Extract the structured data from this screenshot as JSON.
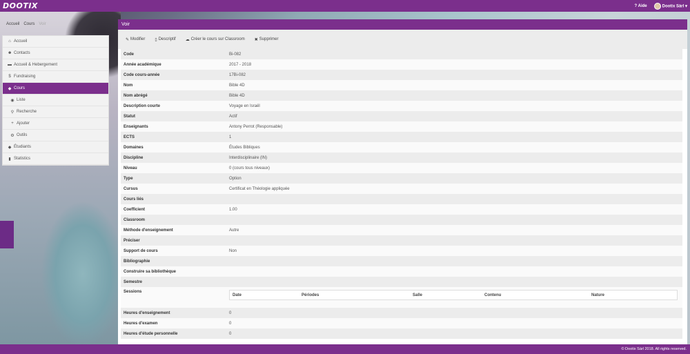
{
  "app": {
    "logo": "DOOTIX",
    "help": "Aide",
    "user": "Dootix Sàrl"
  },
  "breadcrumb": [
    "Accueil",
    "Cours",
    "Voir"
  ],
  "sidebar": {
    "items": [
      {
        "label": "Accueil",
        "icon": "home-icon",
        "glyph": "⌂"
      },
      {
        "label": "Contacts",
        "icon": "users-icon",
        "glyph": "☻"
      },
      {
        "label": "Accueil & Hebergement",
        "icon": "bed-icon",
        "glyph": "▬"
      },
      {
        "label": "Fundraising",
        "icon": "dollar-icon",
        "glyph": "$"
      },
      {
        "label": "Cours",
        "icon": "graduation-cap-icon",
        "glyph": "◆"
      },
      {
        "label": "Liste",
        "icon": "eye-icon",
        "glyph": "◉"
      },
      {
        "label": "Recherche",
        "icon": "search-icon",
        "glyph": "⚲"
      },
      {
        "label": "Ajouter",
        "icon": "plus-icon",
        "glyph": "+"
      },
      {
        "label": "Outils",
        "icon": "gear-icon",
        "glyph": "⚙"
      },
      {
        "label": "Étudiants",
        "icon": "graduation-cap-icon",
        "glyph": "◆"
      },
      {
        "label": "Statistics",
        "icon": "bar-chart-icon",
        "glyph": "▮"
      }
    ]
  },
  "panel": {
    "title": "Voir",
    "actions": [
      {
        "label": "Modifier",
        "icon": "edit-icon",
        "glyph": "✎"
      },
      {
        "label": "Descriptif",
        "icon": "file-icon",
        "glyph": "▯"
      },
      {
        "label": "Créer le cours sur Classroom",
        "icon": "cloud-icon",
        "glyph": "☁"
      },
      {
        "label": "Supprimer",
        "icon": "close-icon",
        "glyph": "✖"
      }
    ]
  },
  "details": [
    {
      "k": "Code",
      "v": "Bi-082"
    },
    {
      "k": "Année académique",
      "v": "2017 - 2018"
    },
    {
      "k": "Code cours-année",
      "v": "17Bi-082"
    },
    {
      "k": "Nom",
      "v": "Bible 4D"
    },
    {
      "k": "Nom abrégé",
      "v": "Bible 4D"
    },
    {
      "k": "Description courte",
      "v": "Voyage en Israël"
    },
    {
      "k": "Statut",
      "v": "Actif"
    },
    {
      "k": "Enseignants",
      "v": "Antony Perrot (Responsable)"
    },
    {
      "k": "ECTS",
      "v": "1"
    },
    {
      "k": "Domaines",
      "v": "Études Bibliques"
    },
    {
      "k": "Discipline",
      "v": "Interdisciplinaire (IN)"
    },
    {
      "k": "Niveau",
      "v": "0 (cours tous niveaux)"
    },
    {
      "k": "Type",
      "v": "Option"
    },
    {
      "k": "Cursus",
      "v": "Certificat en Théologie appliquée"
    },
    {
      "k": "Cours liés",
      "v": ""
    },
    {
      "k": "Coefficient",
      "v": "1.00"
    },
    {
      "k": "Classroom",
      "v": ""
    },
    {
      "k": "Méthode d'enseignement",
      "v": "Autre"
    },
    {
      "k": "Préciser",
      "v": ""
    },
    {
      "k": "Support de cours",
      "v": "Non"
    },
    {
      "k": "Bibliographie",
      "v": ""
    },
    {
      "k": "Construire sa bibliothèque",
      "v": ""
    },
    {
      "k": "Semestre",
      "v": ""
    }
  ],
  "sessions": {
    "label": "Sessions",
    "columns": [
      "Date",
      "Périodes",
      "Salle",
      "Contenu",
      "Nature"
    ]
  },
  "details_after": [
    {
      "k": "Heures d'enseignement",
      "v": "0"
    },
    {
      "k": "Heures d'examen",
      "v": "0"
    },
    {
      "k": "Heures d'étude personnelle",
      "v": "0"
    }
  ],
  "footer": "© Dootix Sàrl 2018. All rights reserved."
}
